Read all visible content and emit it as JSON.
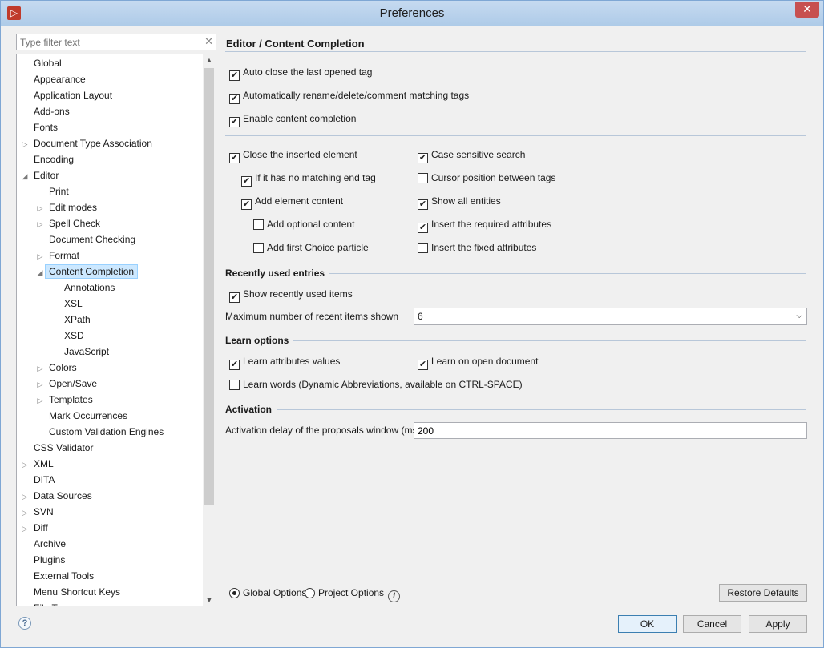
{
  "window": {
    "title": "Preferences",
    "close_glyph": "✕",
    "app_glyph": "▷"
  },
  "filter": {
    "placeholder": "Type filter text",
    "clear_glyph": "✕"
  },
  "tree": [
    {
      "label": "Global",
      "level": 0,
      "twisty": ""
    },
    {
      "label": "Appearance",
      "level": 0,
      "twisty": ""
    },
    {
      "label": "Application Layout",
      "level": 0,
      "twisty": ""
    },
    {
      "label": "Add-ons",
      "level": 0,
      "twisty": ""
    },
    {
      "label": "Fonts",
      "level": 0,
      "twisty": ""
    },
    {
      "label": "Document Type Association",
      "level": 0,
      "twisty": "collapsed"
    },
    {
      "label": "Encoding",
      "level": 0,
      "twisty": ""
    },
    {
      "label": "Editor",
      "level": 0,
      "twisty": "expanded"
    },
    {
      "label": "Print",
      "level": 1,
      "twisty": ""
    },
    {
      "label": "Edit modes",
      "level": 1,
      "twisty": "collapsed"
    },
    {
      "label": "Spell Check",
      "level": 1,
      "twisty": "collapsed"
    },
    {
      "label": "Document Checking",
      "level": 1,
      "twisty": ""
    },
    {
      "label": "Format",
      "level": 1,
      "twisty": "collapsed"
    },
    {
      "label": "Content Completion",
      "level": 1,
      "twisty": "expanded",
      "selected": true
    },
    {
      "label": "Annotations",
      "level": 2,
      "twisty": ""
    },
    {
      "label": "XSL",
      "level": 2,
      "twisty": ""
    },
    {
      "label": "XPath",
      "level": 2,
      "twisty": ""
    },
    {
      "label": "XSD",
      "level": 2,
      "twisty": ""
    },
    {
      "label": "JavaScript",
      "level": 2,
      "twisty": ""
    },
    {
      "label": "Colors",
      "level": 1,
      "twisty": "collapsed"
    },
    {
      "label": "Open/Save",
      "level": 1,
      "twisty": "collapsed"
    },
    {
      "label": "Templates",
      "level": 1,
      "twisty": "collapsed"
    },
    {
      "label": "Mark Occurrences",
      "level": 1,
      "twisty": ""
    },
    {
      "label": "Custom Validation Engines",
      "level": 1,
      "twisty": ""
    },
    {
      "label": "CSS Validator",
      "level": 0,
      "twisty": ""
    },
    {
      "label": "XML",
      "level": 0,
      "twisty": "collapsed"
    },
    {
      "label": "DITA",
      "level": 0,
      "twisty": ""
    },
    {
      "label": "Data Sources",
      "level": 0,
      "twisty": "collapsed"
    },
    {
      "label": "SVN",
      "level": 0,
      "twisty": "collapsed"
    },
    {
      "label": "Diff",
      "level": 0,
      "twisty": "collapsed"
    },
    {
      "label": "Archive",
      "level": 0,
      "twisty": ""
    },
    {
      "label": "Plugins",
      "level": 0,
      "twisty": ""
    },
    {
      "label": "External Tools",
      "level": 0,
      "twisty": ""
    },
    {
      "label": "Menu Shortcut Keys",
      "level": 0,
      "twisty": ""
    },
    {
      "label": "File Types",
      "level": 0,
      "twisty": ""
    }
  ],
  "page_title": "Editor / Content Completion",
  "general": [
    {
      "label": "Auto close the last opened tag",
      "checked": true
    },
    {
      "label": "Automatically rename/delete/comment matching tags",
      "checked": true
    },
    {
      "label": "Enable content completion",
      "checked": true
    }
  ],
  "left_col": [
    {
      "label": "Close the inserted element",
      "checked": true,
      "indent": 0
    },
    {
      "label": "If it has no matching end tag",
      "checked": true,
      "indent": 1
    },
    {
      "label": "Add element content",
      "checked": true,
      "indent": 1
    },
    {
      "label": "Add optional content",
      "checked": false,
      "indent": 2
    },
    {
      "label": "Add first Choice particle",
      "checked": false,
      "indent": 2
    }
  ],
  "right_col": [
    {
      "label": "Case sensitive search",
      "checked": true
    },
    {
      "label": "Cursor position between tags",
      "checked": false
    },
    {
      "label": "Show all entities",
      "checked": true
    },
    {
      "label": "Insert the required attributes",
      "checked": true
    },
    {
      "label": "Insert the fixed attributes",
      "checked": false
    }
  ],
  "recent": {
    "title": "Recently used entries",
    "show_label": "Show recently used items",
    "show_checked": true,
    "max_label": "Maximum number of recent items shown",
    "max_value": "6"
  },
  "learn": {
    "title": "Learn options",
    "attr_label": "Learn attributes values",
    "attr_checked": true,
    "open_doc_label": "Learn on open document",
    "open_doc_checked": true,
    "words_label": "Learn words (Dynamic Abbreviations, available on CTRL-SPACE)",
    "words_checked": false
  },
  "activation": {
    "title": "Activation",
    "delay_label": "Activation delay of the proposals window (ms)",
    "delay_value": "200"
  },
  "options": {
    "global_label": "Global Options",
    "project_label": "Project Options",
    "selected": "global",
    "info_glyph": "i"
  },
  "buttons": {
    "restore": "Restore Defaults",
    "ok": "OK",
    "cancel": "Cancel",
    "apply": "Apply",
    "help_glyph": "?"
  }
}
